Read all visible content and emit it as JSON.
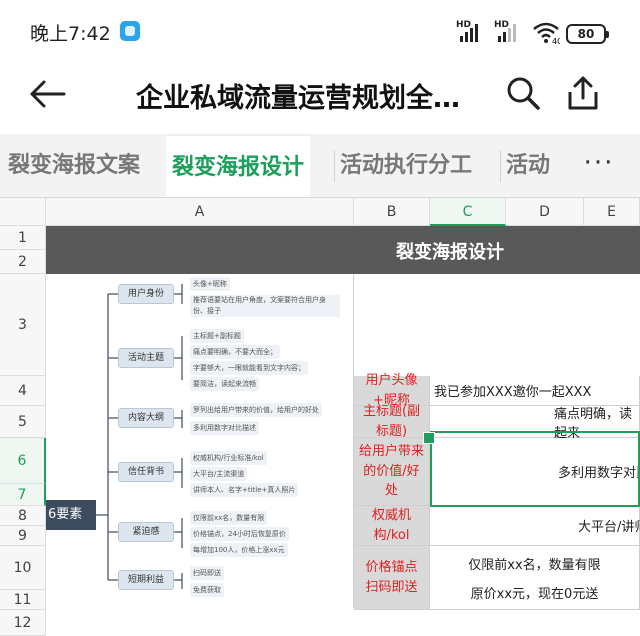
{
  "status": {
    "time": "晚上7:42",
    "sim1_label": "HD",
    "sim2_label": "HD",
    "network": "4G",
    "battery": "80"
  },
  "toolbar": {
    "title": "企业私域流量运营规划全…"
  },
  "tabs": [
    {
      "label": "裂变海报文案",
      "active": false
    },
    {
      "label": "裂变海报设计",
      "active": true
    },
    {
      "label": "活动执行分工",
      "active": false
    },
    {
      "label": "活动",
      "active": false
    }
  ],
  "more_label": "···",
  "columns": [
    "A",
    "B",
    "C",
    "D",
    "E"
  ],
  "rows": [
    "1",
    "2",
    "3",
    "4",
    "5",
    "6",
    "7",
    "8",
    "9",
    "10",
    "11",
    "12"
  ],
  "sheet": {
    "banner": "裂变海报设计",
    "entries": [
      {
        "label": "用户头像+昵称",
        "value": "我已参加XXX邀你一起XXX"
      },
      {
        "label": "主标题(副标题)",
        "value": "痛点明确，读起来"
      },
      {
        "label": "给用户带来的价值/好处",
        "value": "多利用数字对比描"
      },
      {
        "label": "权威机构/kol",
        "value": "大平台/讲师"
      },
      {
        "label": "价格锚点\n扫码即送",
        "value_lines": [
          "仅限前xx名，数量有限",
          "原价xx元，现在0元送"
        ]
      }
    ]
  },
  "mindmap": {
    "root": "6要素",
    "branches": [
      {
        "label": "用户身份",
        "leaves": [
          "头像+昵称",
          "推荐语要站在用户角度，文案要符合用户身份、接子"
        ]
      },
      {
        "label": "活动主题",
        "leaves": [
          "主标题+副标题",
          "痛点要明确，不要大而全；",
          "字要够大，一眼就能看到文字内容；",
          "要简洁，读起来流畅"
        ]
      },
      {
        "label": "内容大纲",
        "leaves": [
          "罗列出给用户带来的价值，给用户的好处",
          "多利用数字对比描述"
        ]
      },
      {
        "label": "信任背书",
        "leaves": [
          "权威机构/行业标准/kol",
          "大平台/主流渠道",
          "讲师本人、名字+title+真人照片"
        ]
      },
      {
        "label": "紧迫感",
        "leaves": [
          "仅限前xx名，数量有限",
          "价格锚点，24小时后恢复原价",
          "每增加100人，价格上涨xx元"
        ]
      },
      {
        "label": "短期利益",
        "leaves": [
          "扫码即送",
          "免费获取"
        ]
      }
    ]
  },
  "colors": {
    "accent": "#1aa05a",
    "banner": "#595959",
    "label_text": "#e02020",
    "label_bg": "#d9d9d9"
  }
}
